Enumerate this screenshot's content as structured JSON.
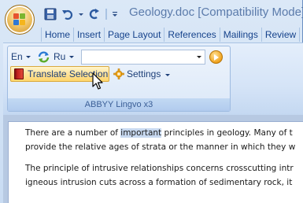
{
  "window": {
    "title": "Geology.doc [Compatibility Mode] -",
    "accent_color": "#15428b"
  },
  "quick_access": {
    "icons": [
      "save-icon",
      "undo-icon",
      "redo-icon",
      "customize-icon"
    ]
  },
  "tabs": [
    {
      "label": "Home"
    },
    {
      "label": "Insert"
    },
    {
      "label": "Page Layout"
    },
    {
      "label": "References"
    },
    {
      "label": "Mailings"
    },
    {
      "label": "Review"
    }
  ],
  "ribbon": {
    "group_caption": "ABBYY Lingvo x3",
    "source_language": "En",
    "target_language": "Ru",
    "lookup_value": "",
    "translate_label": "Translate Selection",
    "settings_label": "Settings"
  },
  "document": {
    "para1_line1_before": "There are a number of ",
    "para1_line1_highlight": "important",
    "para1_line1_after": " principles in geology. Many of t",
    "para1_line2": "provide the relative ages of strata or the manner in which they w",
    "para2_line1": "The principle of intrusive relationships concerns crosscutting intr",
    "para2_line2": "igneous intrusion cuts across a formation of sedimentary rock, it"
  }
}
